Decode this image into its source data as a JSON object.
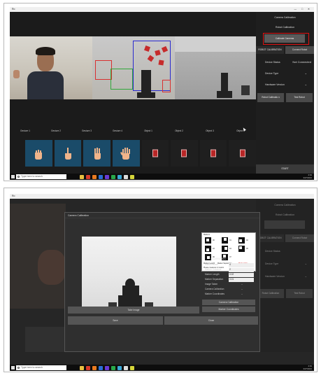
{
  "screen1": {
    "window_title": "Ro",
    "window_controls": "— □ ✕",
    "right_panel": {
      "camera_calibration": "Camera Calibration",
      "robot_calibration": "Robot Calibration",
      "calibrate_cameras_button": "Calibrate Cameras",
      "robot_calibration_tab": "ROBOT CALIBRATION",
      "connect_robot_button": "Connect Robot",
      "device_status_label": "Device Status",
      "device_status_value": "Not Connected",
      "device_type_label": "Device Type",
      "hardware_version_label": "Hardware Version",
      "robot_calibration_button": "Robot Calibratio n",
      "test_robot_button": "Test Robot",
      "start_button": "START"
    },
    "bottom_labels": [
      "Gesture 1",
      "Gesture 2",
      "Gesture 3",
      "Gesture 4",
      "Object 1",
      "Object 2",
      "Object 3",
      "Object 4"
    ],
    "taskbar": {
      "search_placeholder": "Type here to search",
      "time": "4:01",
      "date": "3/27/2021"
    }
  },
  "screen2": {
    "window_title": "Ro",
    "dialog_title": "Camera Calibration",
    "marker_panel_title": "Markers",
    "marker_ids": [
      "00",
      "01",
      "02",
      "03",
      "04",
      "05",
      "06",
      "07"
    ],
    "marker_footer": [
      "Marker Length",
      "Marker Separation",
      "Marker Size",
      "Please measure in meters"
    ],
    "calibration_header": "CALIBRATION",
    "fields": [
      {
        "label": "Marker Rows",
        "value": "4"
      },
      {
        "label": "Marker Columns",
        "value": "2"
      },
      {
        "label": "Marker Length",
        "value": "0.02"
      },
      {
        "label": "Marker Separation",
        "value": "0.01"
      }
    ],
    "status_rows": [
      {
        "label": "Image Taken",
        "value": "--"
      },
      {
        "label": "Camera Calibration",
        "value": "--"
      },
      {
        "label": "Marker Coordinates",
        "value": "--"
      }
    ],
    "buttons": {
      "take_image": "Take Image",
      "camera_calibration": "Camera Calibration",
      "marker_coordinates": "Marker Coordinates",
      "save": "Save",
      "close": "Close"
    },
    "side_panel": {
      "camera_calibration": "Camera Calibration",
      "robot_calibration": "Robot Calibration",
      "robot_calibration_tab": "ROBOT CALIBRATION",
      "connect_robot": "Connect Robot",
      "device_status": "Device Status",
      "device_type": "Device Type",
      "hardware_version": "Hardware Version",
      "robot_calibration_button": "Robot Calibration",
      "test_robot": "Test Robot"
    },
    "taskbar": {
      "search_placeholder": "Type here to search",
      "time": "4:01",
      "date": "3/27/2021"
    }
  },
  "colors": {
    "highlight": "#e01010",
    "tile_blue": "#1a4b69",
    "panel_bg": "#1e1e1e",
    "button_bg": "#4a4a4a"
  }
}
